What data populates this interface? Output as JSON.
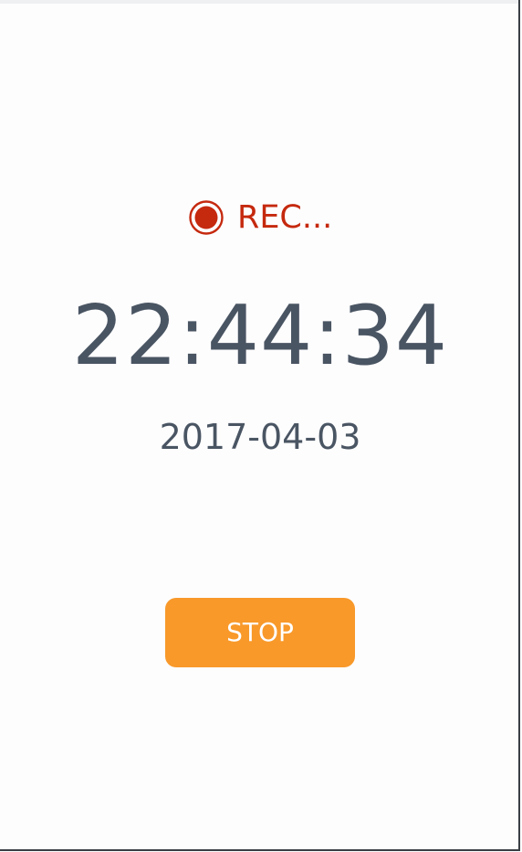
{
  "recording": {
    "icon": "record-icon",
    "label": "REC...",
    "color": "#c5290e"
  },
  "clock": {
    "time": "22:44:34",
    "date": "2017-04-03"
  },
  "actions": {
    "stop_label": "STOP",
    "stop_color": "#f8992a"
  }
}
